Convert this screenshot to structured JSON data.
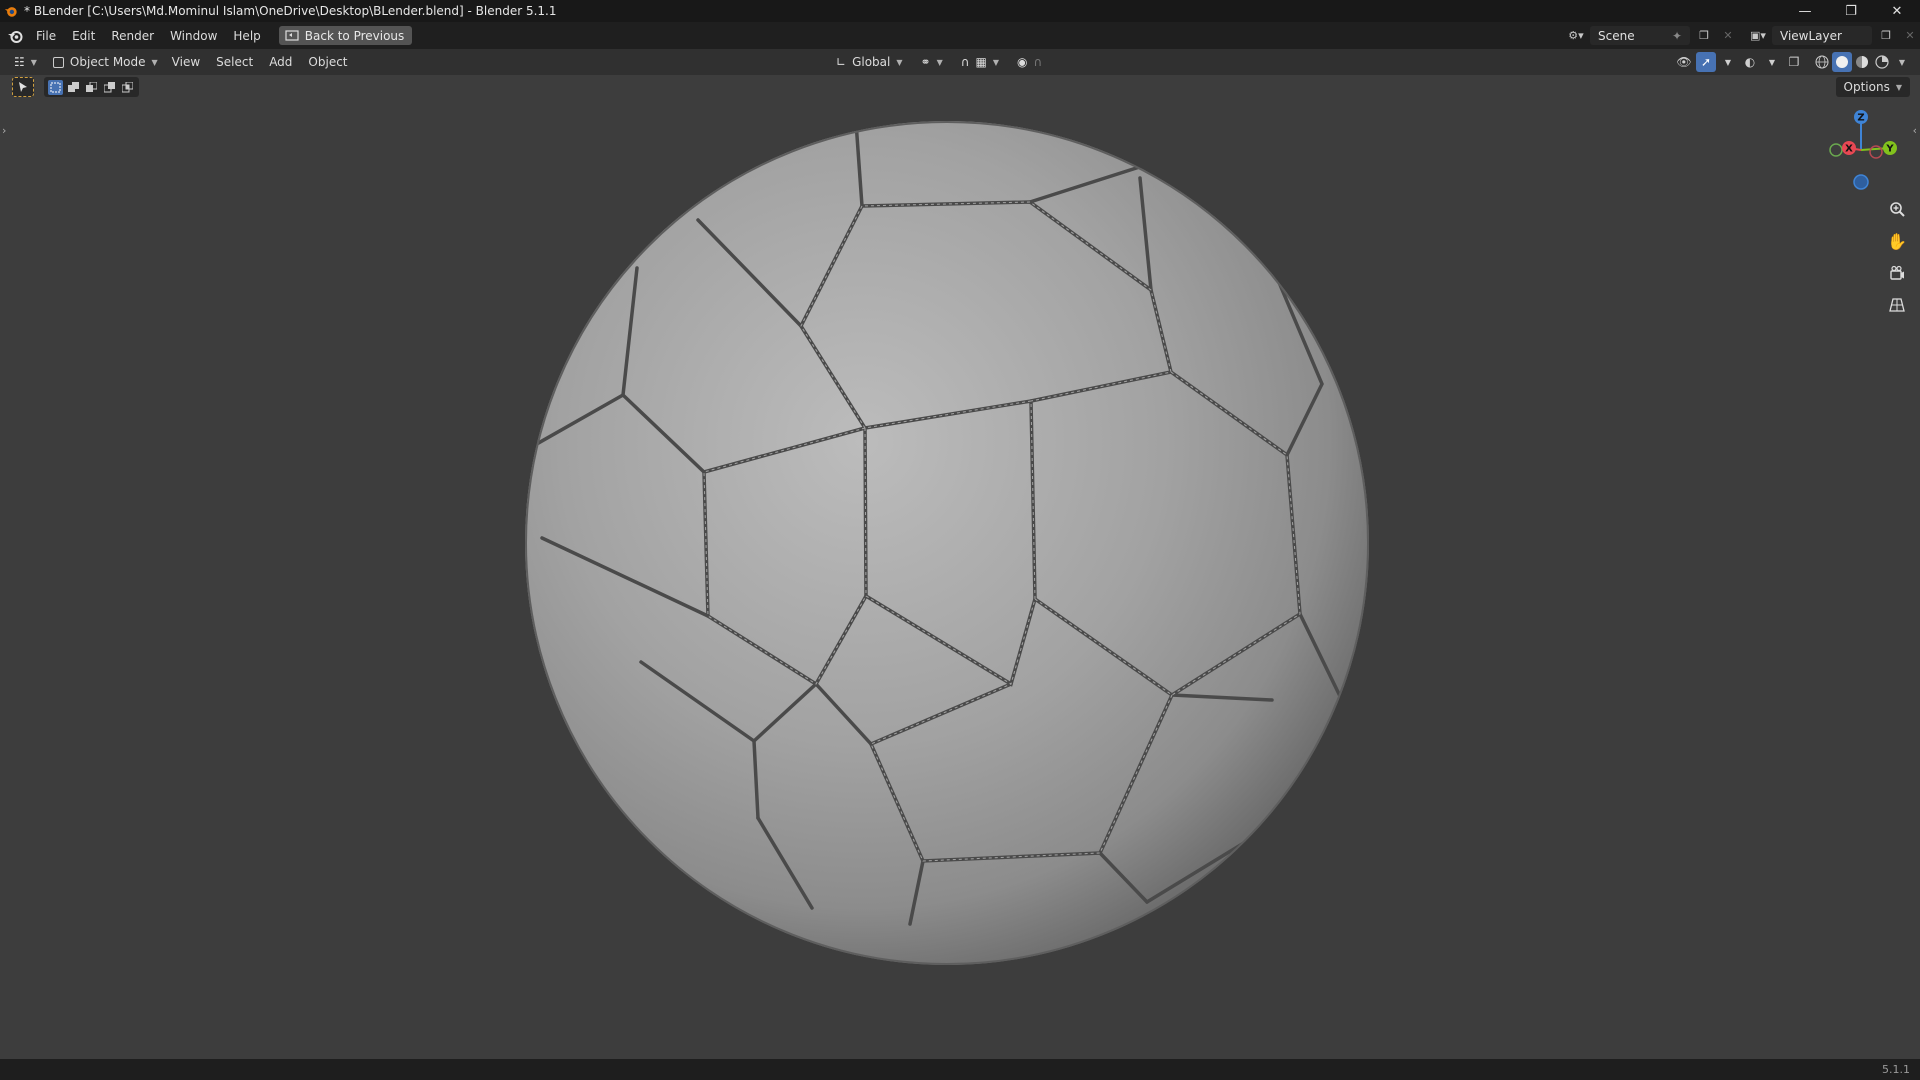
{
  "window": {
    "title": "* BLender [C:\\Users\\Md.Mominul Islam\\OneDrive\\Desktop\\BLender.blend] - Blender 5.1.1",
    "controls": [
      "minimize",
      "maximize",
      "close"
    ]
  },
  "menubar": {
    "items": [
      "File",
      "Edit",
      "Render",
      "Window",
      "Help"
    ],
    "back_button": "Back to Previous",
    "scene": "Scene",
    "view_layer": "ViewLayer"
  },
  "viewport_header": {
    "mode": "Object Mode",
    "menus": [
      "View",
      "Select",
      "Add",
      "Object"
    ],
    "transform_orientation": "Global",
    "shading_active": "solid"
  },
  "viewport": {
    "options_label": "Options",
    "gizmo_axes": {
      "x": "X",
      "y": "Y",
      "z": "Z"
    },
    "object": "soccer-ball"
  },
  "colors": {
    "accent": "#4772b3",
    "axis_x": "#e84853",
    "axis_y": "#82c21d",
    "axis_z": "#3f84d6"
  },
  "statusbar": {
    "version": "5.1.1"
  }
}
